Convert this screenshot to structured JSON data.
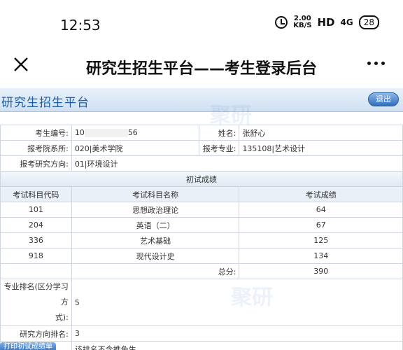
{
  "status_bar": {
    "time": "12:53",
    "speed_value": "2.00",
    "speed_unit": "KB/S",
    "hd": "HD",
    "signal": "4G",
    "battery": "28"
  },
  "app_bar": {
    "title": "研究生招生平台——考生登录后台"
  },
  "portal": {
    "title": "研究生招生平台",
    "exit_label": "退出"
  },
  "info": {
    "exam_no_label": "考生编号:",
    "exam_no_start": "10",
    "exam_no_end": "56",
    "name_label": "姓名:",
    "name_value": "张舒心",
    "dept_label": "报考院系所:",
    "dept_value": "020|美术学院",
    "major_label": "报考专业:",
    "major_value": "135108|艺术设计",
    "direction_label": "报考研究方向:",
    "direction_value": "01|环境设计"
  },
  "scores": {
    "section_title": "初试成绩",
    "headers": [
      "考试科目代码",
      "考试科目名称",
      "考试成绩"
    ],
    "rows": [
      {
        "code": "101",
        "name": "思想政治理论",
        "score": "64"
      },
      {
        "code": "204",
        "name": "英语（二）",
        "score": "67"
      },
      {
        "code": "336",
        "name": "艺术基础",
        "score": "125"
      },
      {
        "code": "918",
        "name": "现代设计史",
        "score": "134"
      }
    ],
    "total_label": "总分:",
    "total_value": "390"
  },
  "ranking": {
    "major_rank_label_1": "专业排名(区分学习方",
    "major_rank_label_2": "式):",
    "major_rank_value": "5",
    "direction_rank_label": "研究方向排名:",
    "direction_rank_value": "3",
    "note": "该排名不含推免生"
  },
  "print_button": "打印初试成绩单"
}
